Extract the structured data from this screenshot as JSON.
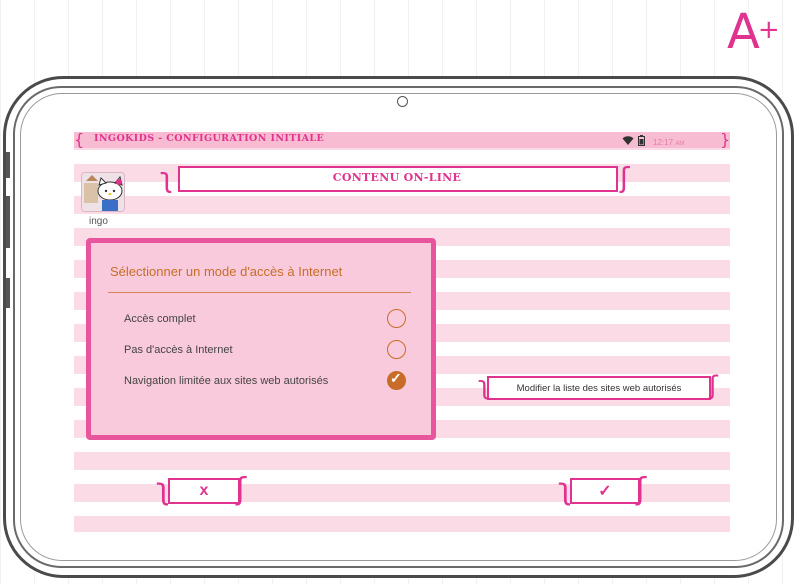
{
  "grade": {
    "main": "A",
    "plus": "+"
  },
  "statusbar": {
    "title": "INGOKIDS - CONFIGURATION INITIALE",
    "time": "12:17",
    "time_suffix": "AM",
    "wifi_icon": "wifi-icon",
    "battery_icon": "battery-icon"
  },
  "header": {
    "title": "CONTENU ON-LINE"
  },
  "user": {
    "name": "ingo",
    "avatar_icon": "hello-kitty-avatar"
  },
  "panel": {
    "title": "Sélectionner un mode d'accès à Internet",
    "options": [
      {
        "label": "Accès complet",
        "selected": false
      },
      {
        "label": "Pas d'accès à Internet",
        "selected": false
      },
      {
        "label": "Navigation limitée aux sites web autorisés",
        "selected": true
      }
    ]
  },
  "modify_button": {
    "label": "Modifier la liste des sites web autorisés"
  },
  "buttons": {
    "cancel_glyph": "x",
    "confirm_glyph": "✓"
  },
  "colors": {
    "accent": "#e0338f",
    "panel_bg": "#f9cadb",
    "option_color": "#c86d28",
    "stripe": "#fadbe6"
  }
}
